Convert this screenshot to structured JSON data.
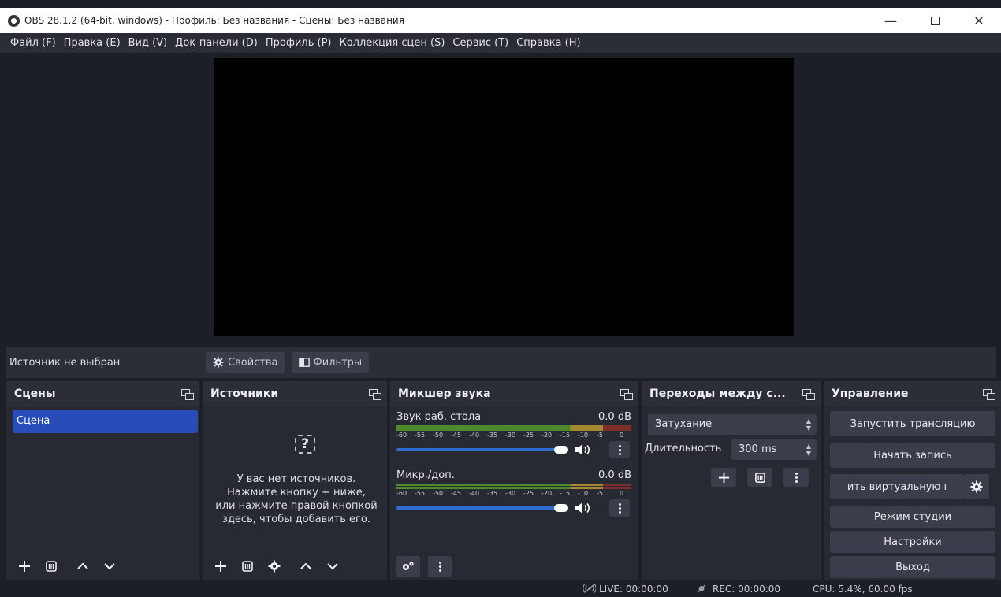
{
  "window": {
    "title": "OBS 28.1.2 (64-bit, windows) - Профиль: Без названия - Сцены: Без названия",
    "minimize": "—",
    "close": "✕"
  },
  "menu": [
    "Файл (F)",
    "Правка (E)",
    "Вид (V)",
    "Док-панели (D)",
    "Профиль (P)",
    "Коллекция сцен (S)",
    "Сервис (T)",
    "Справка (H)"
  ],
  "source_bar": {
    "no_source": "Источник не выбран",
    "properties": "Свойства",
    "filters": "Фильтры"
  },
  "scenes": {
    "title": "Сцены",
    "items": [
      "Сцена"
    ]
  },
  "sources": {
    "title": "Источники",
    "empty_icon": "?",
    "empty_lines": [
      "У вас нет источников.",
      "Нажмите кнопку + ниже,",
      "или нажмите правой кнопкой",
      "здесь, чтобы добавить его."
    ]
  },
  "mixer": {
    "title": "Микшер звука",
    "ticks": [
      "-60",
      "-55",
      "-50",
      "-45",
      "-40",
      "-35",
      "-30",
      "-25",
      "-20",
      "-15",
      "-10",
      "-5",
      "0"
    ],
    "channels": [
      {
        "name": "Звук раб. стола",
        "level": "0.0 dB",
        "volume_fraction": 1.0
      },
      {
        "name": "Микр./доп.",
        "level": "0.0 dB",
        "volume_fraction": 1.0
      }
    ]
  },
  "transitions": {
    "title": "Переходы между с...",
    "selected": "Затухание",
    "duration_label": "Длительность",
    "duration_value": "300 ms",
    "add": "+"
  },
  "controls": {
    "title": "Управление",
    "start_stream": "Запустить трансляцию",
    "start_record": "Начать запись",
    "virtual_cam": "ить виртуальную ı",
    "studio_mode": "Режим студии",
    "settings": "Настройки",
    "exit": "Выход"
  },
  "status": {
    "live": "LIVE: 00:00:00",
    "rec": "REC: 00:00:00",
    "cpu": "CPU: 5.4%, 60.00 fps"
  },
  "colors": {
    "accent": "#284cb8",
    "volume": "#2f6bd0",
    "panel": "#272a33",
    "background": "#1d1f26"
  }
}
